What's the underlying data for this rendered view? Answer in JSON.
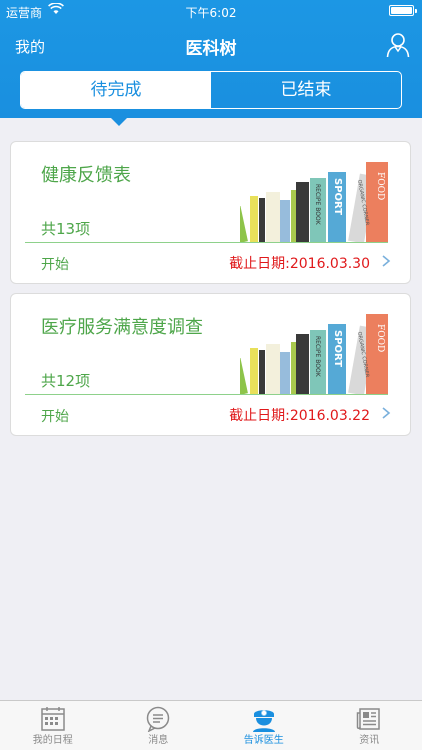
{
  "status_bar": {
    "carrier": "运营商",
    "time": "下午6:02"
  },
  "nav": {
    "left_label": "我的",
    "title": "医科树"
  },
  "segments": [
    {
      "label": "待完成",
      "active": true
    },
    {
      "label": "已结束",
      "active": false
    }
  ],
  "cards": [
    {
      "title": "健康反馈表",
      "count": "共13项",
      "action": "开始",
      "deadline": "截止日期:2016.03.30"
    },
    {
      "title": "医疗服务满意度调查",
      "count": "共12项",
      "action": "开始",
      "deadline": "截止日期:2016.03.22"
    }
  ],
  "book_spines": [
    "FOOD",
    "ORGANIC CORNER",
    "SPORT",
    "RECIPE BOOK"
  ],
  "tabbar": [
    {
      "label": "我的日程",
      "icon": "calendar-icon"
    },
    {
      "label": "消息",
      "icon": "message-icon"
    },
    {
      "label": "告诉医生",
      "icon": "doctor-icon",
      "active": true
    },
    {
      "label": "资讯",
      "icon": "news-icon"
    }
  ],
  "colors": {
    "primary": "#1a8fdf",
    "green": "#4ea64a",
    "red": "#e0191b",
    "background": "#efeff4"
  }
}
